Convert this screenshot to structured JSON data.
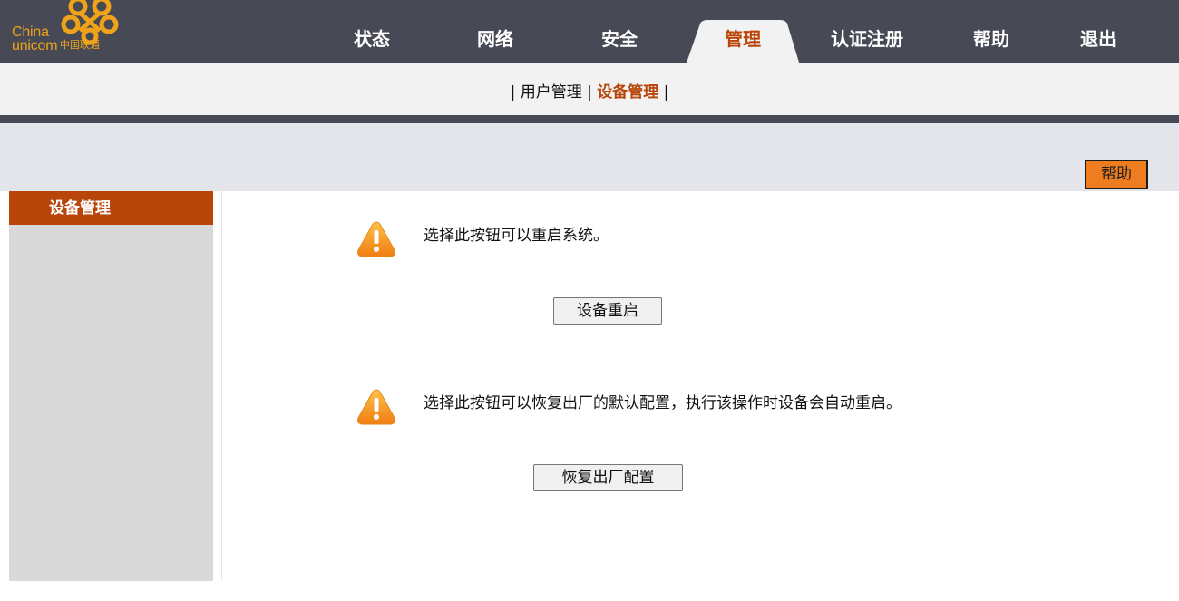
{
  "logo": {
    "text_en_line1": "China",
    "text_en_line2": "unicom",
    "text_cn": "中国联通",
    "color": "#f0a319"
  },
  "nav": {
    "items": [
      {
        "label": "状态"
      },
      {
        "label": "网络"
      },
      {
        "label": "安全"
      },
      {
        "label": "管理",
        "active": true
      },
      {
        "label": "认证注册"
      },
      {
        "label": "帮助"
      },
      {
        "label": "退出"
      }
    ]
  },
  "subnav": {
    "separator": "|",
    "items": [
      {
        "label": "用户管理"
      },
      {
        "label": "设备管理",
        "active": true
      }
    ]
  },
  "help_button": {
    "label": "帮助"
  },
  "sidebar": {
    "title": "设备管理"
  },
  "content": {
    "reboot": {
      "icon": "warning-icon",
      "message": "选择此按钮可以重启系统。",
      "button_label": "设备重启"
    },
    "factory_reset": {
      "icon": "warning-icon",
      "message": "选择此按钮可以恢复出厂的默认配置，执行该操作时设备会自动重启。",
      "button_label": "恢复出厂配置"
    }
  },
  "colors": {
    "topbar": "#474a55",
    "accent": "#b8460b",
    "help_button": "#ee7d1f",
    "sidebar": "#d9d9d9"
  }
}
